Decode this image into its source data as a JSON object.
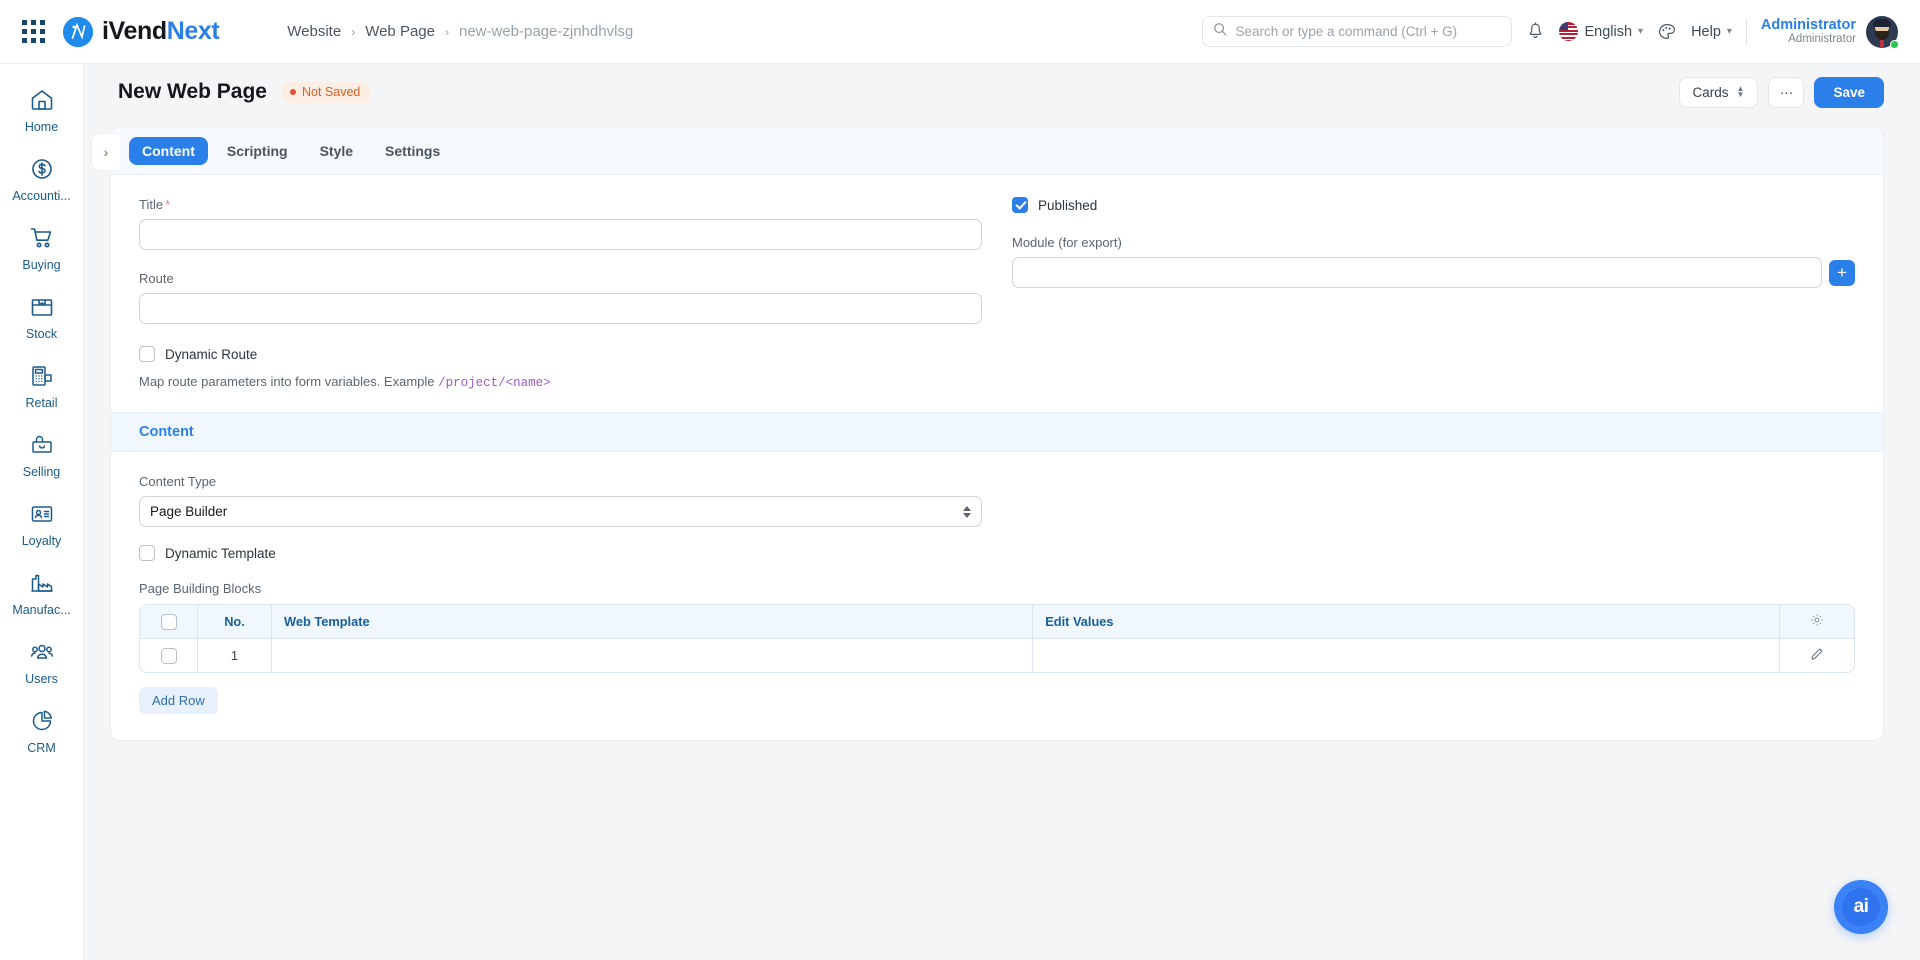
{
  "app": {
    "brand_first": "iVend",
    "brand_second": "Next"
  },
  "navbar": {
    "breadcrumb": [
      {
        "label": "Website",
        "current": false
      },
      {
        "label": "Web Page",
        "current": false
      },
      {
        "label": "new-web-page-zjnhdhvlsg",
        "current": true
      }
    ],
    "separator": "›",
    "search": {
      "placeholder": "Search or type a command (Ctrl + G)",
      "value": ""
    },
    "language": "English",
    "help": "Help",
    "user": {
      "name": "Administrator",
      "role": "Administrator"
    }
  },
  "sidebar": {
    "items": [
      {
        "label": "Home",
        "icon": "home-icon"
      },
      {
        "label": "Accounti...",
        "icon": "dollar-circle-icon"
      },
      {
        "label": "Buying",
        "icon": "shopping-cart-icon"
      },
      {
        "label": "Stock",
        "icon": "box-icon"
      },
      {
        "label": "Retail",
        "icon": "pos-terminal-icon"
      },
      {
        "label": "Selling",
        "icon": "shopping-bag-icon"
      },
      {
        "label": "Loyalty",
        "icon": "id-card-icon"
      },
      {
        "label": "Manufac...",
        "icon": "factory-icon"
      },
      {
        "label": "Users",
        "icon": "users-icon"
      },
      {
        "label": "CRM",
        "icon": "pie-chart-icon"
      }
    ]
  },
  "page": {
    "title": "New Web Page",
    "status_badge": "Not Saved",
    "actions": {
      "view_select": "Cards",
      "menu": "···",
      "save": "Save"
    },
    "collapse_toggle": "›"
  },
  "tabs": [
    {
      "label": "Content",
      "active": true
    },
    {
      "label": "Scripting",
      "active": false
    },
    {
      "label": "Style",
      "active": false
    },
    {
      "label": "Settings",
      "active": false
    }
  ],
  "form": {
    "title_field": {
      "label": "Title",
      "required": "*",
      "value": "",
      "placeholder": ""
    },
    "route_field": {
      "label": "Route",
      "value": "",
      "placeholder": ""
    },
    "dynamic_route": {
      "label": "Dynamic Route",
      "checked": false
    },
    "route_help_text": "Map route parameters into form variables. Example ",
    "route_help_code": "/project/<name>",
    "published": {
      "label": "Published",
      "checked": true
    },
    "module_field": {
      "label": "Module (for export)",
      "value": "",
      "placeholder": ""
    },
    "module_add_button": "+"
  },
  "content_section": {
    "heading": "Content",
    "content_type": {
      "label": "Content Type",
      "value": "Page Builder"
    },
    "dynamic_template": {
      "label": "Dynamic Template",
      "checked": false
    },
    "grid": {
      "label": "Page Building Blocks",
      "columns": [
        "",
        "No.",
        "Web Template",
        "Edit Values",
        ""
      ],
      "rows": [
        {
          "no": "1",
          "web_template": "",
          "edit_values": ""
        }
      ],
      "add_row_button": "Add Row",
      "settings_icon": "gear-icon",
      "row_edit_icon": "pencil-icon"
    }
  },
  "fab": {
    "label": "ai"
  },
  "colors": {
    "accent": "#2a7fe8",
    "sidebar_text": "#1b5b8c",
    "not_saved_text": "#d4622a",
    "not_saved_bg": "#fdeee3",
    "section_heading": "#2a7fe8",
    "code_text": "#9b59c9"
  }
}
